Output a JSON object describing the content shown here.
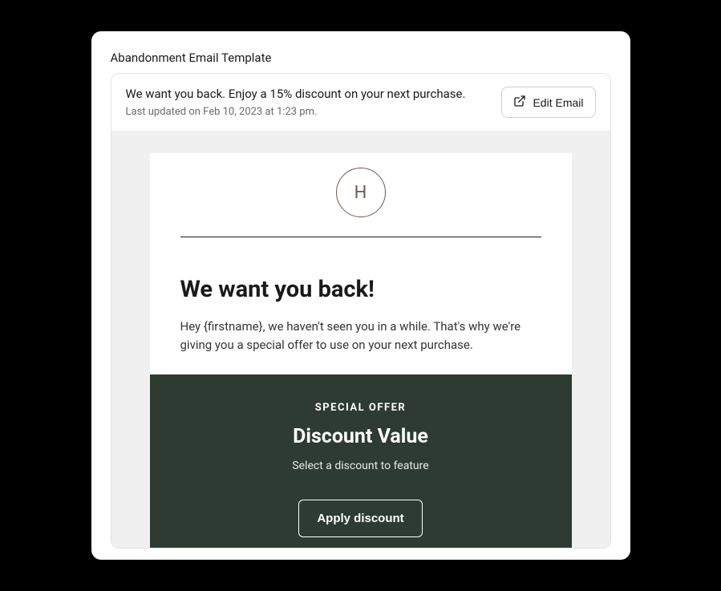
{
  "section_title": "Abandonment Email Template",
  "header": {
    "subject": "We want you back. Enjoy a 15% discount on your next purchase.",
    "last_updated": "Last updated on Feb 10, 2023 at 1:23 pm.",
    "edit_label": "Edit Email"
  },
  "email": {
    "logo_letter": "H",
    "heading": "We want you back!",
    "body": "Hey {firstname}, we haven't seen you in a while. That's why we're giving you a special offer to use on your next purchase.",
    "offer": {
      "label": "SPECIAL OFFER",
      "value": "Discount Value",
      "hint": "Select a discount to feature",
      "button": "Apply discount"
    }
  }
}
